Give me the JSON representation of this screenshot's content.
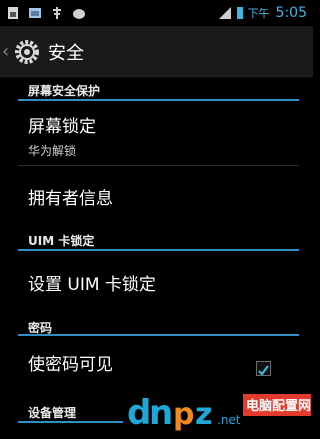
{
  "status_bar": {
    "ampm": "下午",
    "time": "5:05"
  },
  "action_bar": {
    "title": "安全"
  },
  "sections": {
    "screen_security": {
      "header": "屏幕安全保护",
      "items": [
        {
          "title": "屏幕锁定",
          "subtitle": "华为解锁"
        },
        {
          "title": "拥有者信息"
        }
      ]
    },
    "uim_lock": {
      "header": "UIM 卡锁定",
      "items": [
        {
          "title": "设置 UIM 卡锁定"
        }
      ]
    },
    "password": {
      "header": "密码",
      "items": [
        {
          "title": "使密码可见",
          "checked": true
        }
      ]
    },
    "device_admin": {
      "header": "设备管理"
    }
  },
  "watermark": {
    "logo_text": "dnpz.net",
    "site_name": "电脑配置网"
  },
  "colors": {
    "accent": "#3fb6e6",
    "divider_accent": "#2f8fc4",
    "background": "#000000"
  }
}
